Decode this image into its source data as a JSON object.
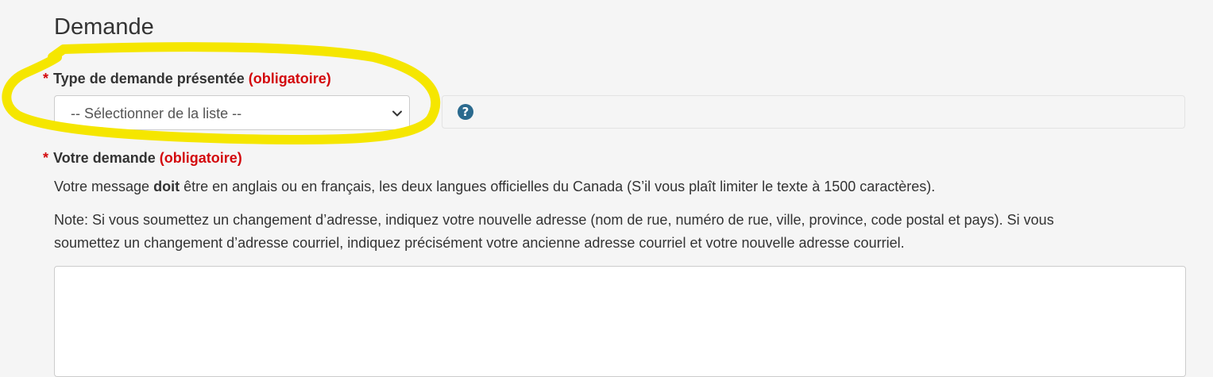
{
  "section": {
    "title": "Demande"
  },
  "type_field": {
    "required_star": "*",
    "label": "Type de demande présentée",
    "required_text": "(obligatoire)",
    "select_value": "-- Sélectionner de la liste --",
    "help_icon": "question-circle-icon"
  },
  "request_field": {
    "required_star": "*",
    "label": "Votre demande",
    "required_text": "(obligatoire)",
    "instruction_before": "Votre message ",
    "instruction_bold": "doit",
    "instruction_after": " être en anglais ou en français, les deux langues officielles du Canada (S’il vous plaît limiter le texte à 1500 caractères).",
    "note_line_1": "Note: Si vous soumettez un changement d’adresse, indiquez votre nouvelle adresse (nom de rue, numéro de rue, ville, province, code postal et pays). Si vous",
    "note_line_2": "soumettez un changement d’adresse courriel, indiquez précisément votre ancienne adresse courriel et votre nouvelle adresse courriel.",
    "textarea_value": ""
  },
  "colors": {
    "required": "#d3080c",
    "highlight": "#f5e600",
    "help_icon": "#2b6a8e"
  }
}
